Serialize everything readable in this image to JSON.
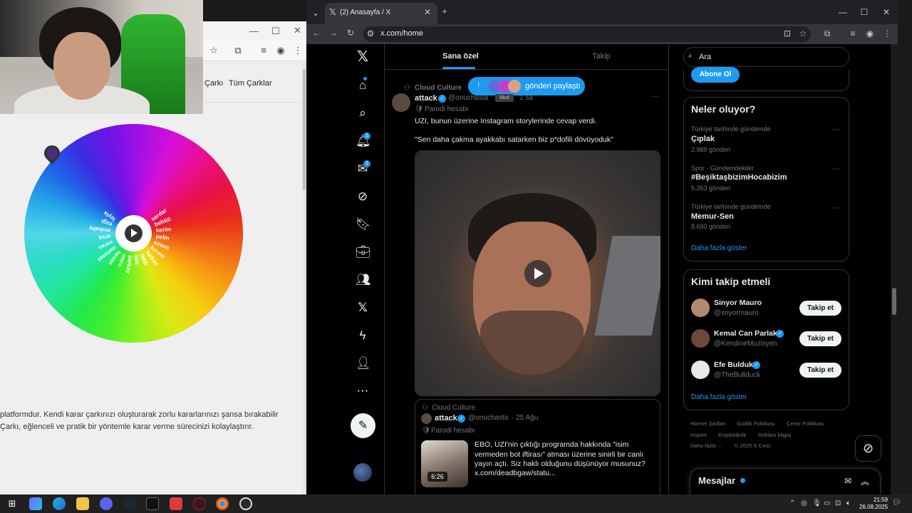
{
  "left_window": {
    "nav_links": [
      "Çarkı",
      "Tüm Çarklar"
    ],
    "description_lines": [
      "platformdur. Kendi karar çarkınızı oluşturarak zorlu kararlarınızı şansa bırakabilir",
      "Çarkı, eğlenceli ve pratik bir yöntemle karar verme sürecinizi kolaylaştırır."
    ],
    "wheel_labels": [
      "serdar",
      "behlül",
      "kerim",
      "pelin",
      "sinem",
      "kerem",
      "furkan",
      "fatih",
      "lale",
      "berkay",
      "emre",
      "hasan",
      "mehmet",
      "ceren",
      "erva",
      "mxbaby",
      "ezgi",
      "leyla"
    ]
  },
  "browser": {
    "tab_title": "(2) Anasayfa / X",
    "url": "x.com/home"
  },
  "sidebar": {
    "notification_badge": "1",
    "message_badge": "1"
  },
  "feed": {
    "tabs": [
      "Sana özel",
      "Takip"
    ],
    "new_posts_pill": "gönderi paylaştı",
    "post": {
      "community": "Cloud Culture",
      "author": "attack",
      "handle": "@onuchasta",
      "mod_label": "Mod",
      "time": "1 sa",
      "parody_label": "Parodi hesabı",
      "text_line1": "UZI, bunun üzerine Instagram storylerinde cevap verdi.",
      "text_line2": "\"Sen daha çakma ayakkabı satarken biz p*dofili dövüyoduk\""
    },
    "quote": {
      "community": "Cloud Culture",
      "author": "attack",
      "handle": "@onuchasta",
      "date": "· 25 Ağu",
      "parody_label": "Parodi hesabı",
      "duration": "6:26",
      "text_lines": [
        "EBO, UZI'nin çıktığı programda hakkında \"isim",
        "vermeden bot iftirası\" atması üzerine sinirli bir canlı",
        "yayın açtı. Siz haklı olduğunu düşünüyor musunuz?",
        "x.com/deadbgaw/statu..."
      ]
    }
  },
  "right": {
    "search_placeholder": "Ara",
    "subscribe_label": "Abone Ol",
    "trends_title": "Neler oluyor?",
    "trends": [
      {
        "category": "Türkiye tarihinde gündemde",
        "name": "Çıplak",
        "count": "2.989 gönderi"
      },
      {
        "category": "Spor · Gündemdekiler",
        "name": "#BeşiktaşbizimHocabizim",
        "count": "5.353 gönderi"
      },
      {
        "category": "Türkiye tarihinde gündemde",
        "name": "Memur-Sen",
        "count": "8.690 gönderi"
      }
    ],
    "show_more": "Daha fazla göster",
    "who_to_follow_title": "Kimi takip etmeli",
    "suggestions": [
      {
        "name": "Sinyor Mauro",
        "handle": "@snyormauro",
        "button": "Takip et"
      },
      {
        "name": "Kemal Can Parlak",
        "handle": "@KendineMuzisyen",
        "button": "Takip et"
      },
      {
        "name": "Efe Bulduk",
        "handle": "@TheBullduck",
        "button": "Takip et"
      }
    ],
    "show_more_2": "Daha fazla göster",
    "footer": [
      "Hizmet Şartları",
      "Gizlilik Politikası",
      "Çerez Politikası",
      "Imprint",
      "Erişilebilirlik",
      "Reklam bilgisi",
      "Daha fazla ···",
      "© 2025 X Corp."
    ],
    "messages_title": "Mesajlar"
  },
  "taskbar": {
    "time": "21:59",
    "date": "26.08.2025"
  }
}
